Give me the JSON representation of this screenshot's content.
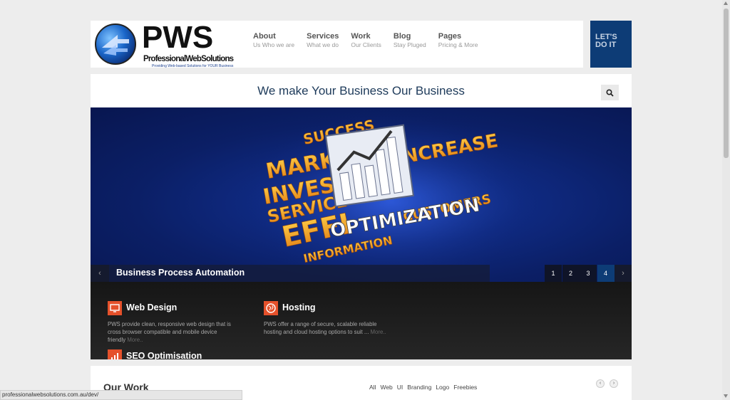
{
  "brand": {
    "name": "PWS",
    "full_name": "ProfessionalWebSolutions",
    "tagline": "Providing Web-based Solutions for YOUR Business"
  },
  "nav": [
    {
      "label": "About",
      "sub": "Us Who we are"
    },
    {
      "label": "Services",
      "sub": "What we do"
    },
    {
      "label": "Work",
      "sub": "Our Clients"
    },
    {
      "label": "Blog",
      "sub": "Stay Pluged"
    },
    {
      "label": "Pages",
      "sub": "Pricing & More"
    }
  ],
  "cta": {
    "line1": "LET'S",
    "line2": "DO IT"
  },
  "hero": {
    "tagline": "We make Your Business Our Business"
  },
  "slider": {
    "art_words": [
      "MARKE",
      "INVEST",
      "SERVICE",
      "EFFI",
      "INCREASE",
      "OPTIMIZATION",
      "CUSTOMERS",
      "INFORMATION",
      "SUCCESS"
    ],
    "caption": "Business Process Automation",
    "prev": "‹",
    "next": "›",
    "pages": [
      "1",
      "2",
      "3",
      "4"
    ],
    "active_page": "4"
  },
  "services": [
    {
      "title": "Web Design",
      "desc": "PWS provide clean, responsive web design that is cross browser compatible and mobile device friendly",
      "more": "More..",
      "icon": "monitor-icon"
    },
    {
      "title": "Hosting",
      "desc": "PWS offer a range of secure, scalable reliable hosting and cloud hosting options to suit ...",
      "more": "More..",
      "icon": "globe-icon"
    },
    {
      "title": "SEO Optimisation",
      "icon": "chart-icon"
    }
  ],
  "work": {
    "title": "Our Work",
    "filters": [
      "All",
      "Web",
      "UI",
      "Branding",
      "Logo",
      "Freebies"
    ],
    "prev": "‹",
    "next": "›"
  },
  "status_url": "professionalwebsolutions.com.au/dev/",
  "colors": {
    "accent": "#0d3c76",
    "service_icon": "#e5512b",
    "background": "#ededed"
  }
}
